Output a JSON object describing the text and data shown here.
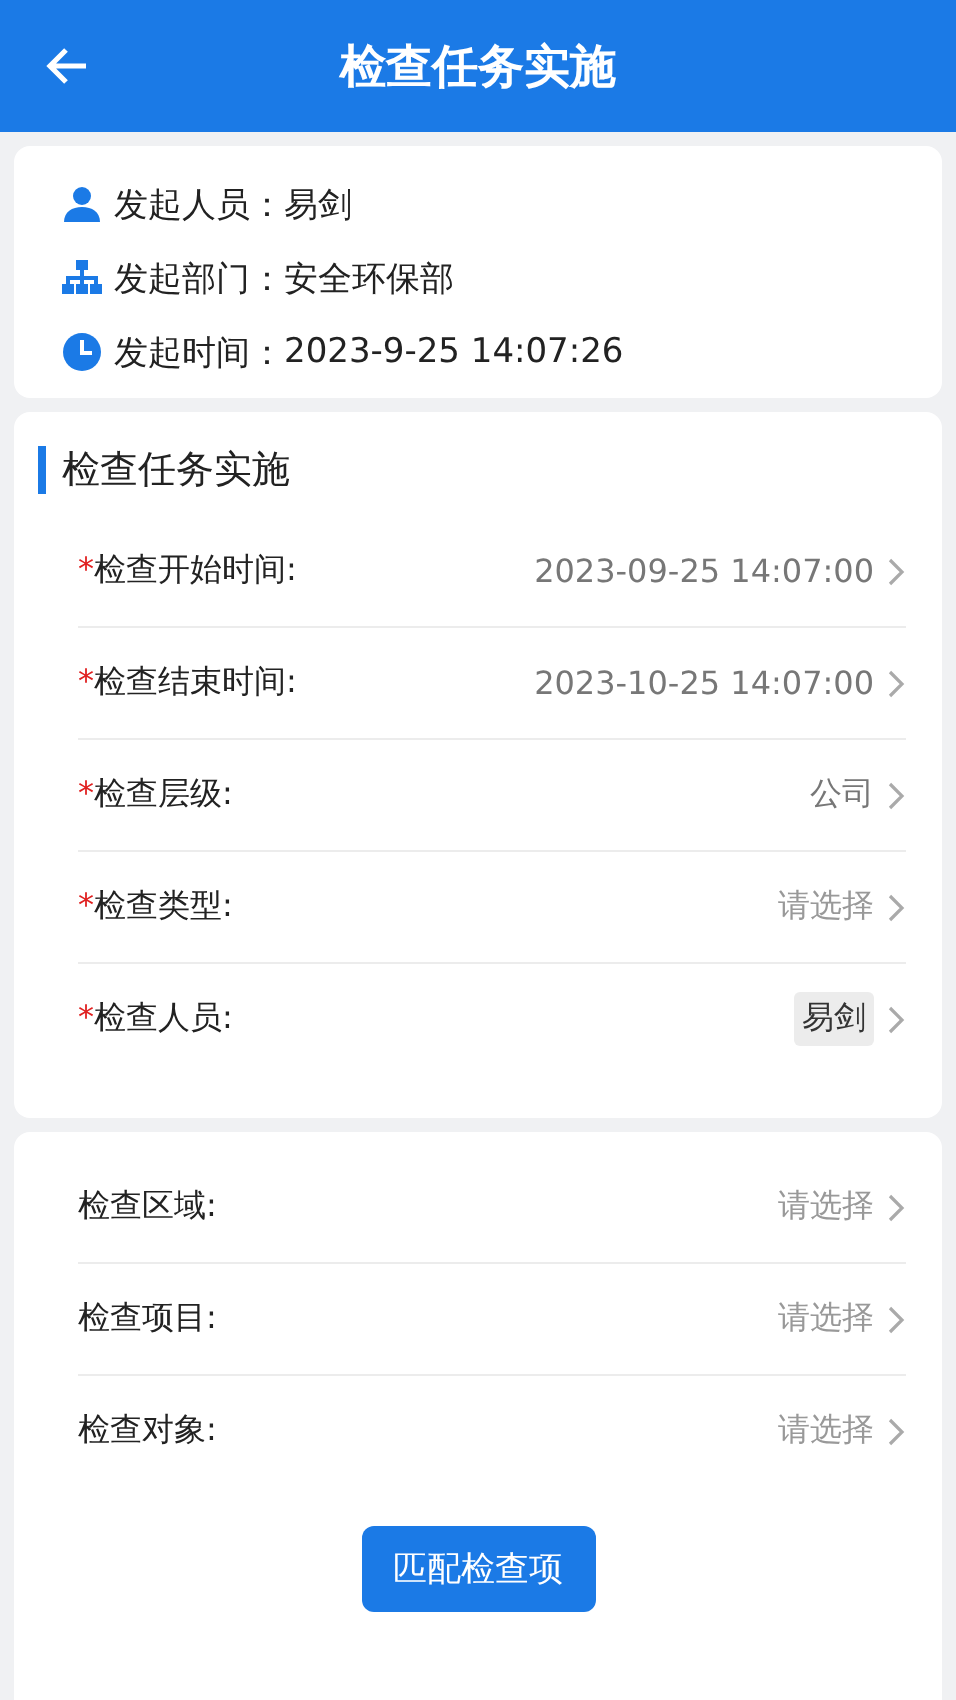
{
  "header": {
    "title": "检查任务实施"
  },
  "info": [
    {
      "kind": "person",
      "label": "发起人员：",
      "value": "易剑"
    },
    {
      "kind": "org",
      "label": "发起部门：",
      "value": "安全环保部"
    },
    {
      "kind": "clock",
      "label": "发起时间：",
      "value": "2023-9-25 14:07:26"
    }
  ],
  "task": {
    "title": "检查任务实施",
    "fields": [
      {
        "mark": "*",
        "label": "检查开始时间:",
        "value": "2023-09-25 14:07:00",
        "tag": false
      },
      {
        "mark": "*",
        "label": "检查结束时间:",
        "value": "2023-10-25 14:07:00",
        "tag": false
      },
      {
        "mark": "*",
        "label": "检查层级:",
        "value": "公司",
        "tag": false
      },
      {
        "mark": "*",
        "label": "检查类型:",
        "placeholder": "请选择"
      },
      {
        "mark": "*",
        "label": "检查人员:",
        "value": "易剑",
        "tag": true
      }
    ]
  },
  "scope": {
    "fields": [
      {
        "label": "检查区域:",
        "placeholder": "请选择"
      },
      {
        "label": "检查项目:",
        "placeholder": "请选择"
      },
      {
        "label": "检查对象:",
        "placeholder": "请选择"
      }
    ],
    "button": "匹配检查项"
  }
}
